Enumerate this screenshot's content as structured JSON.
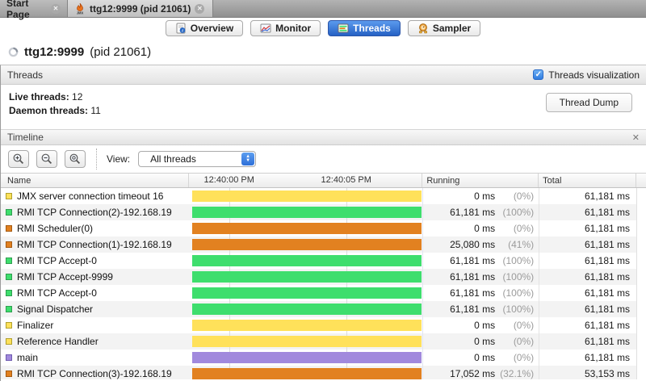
{
  "window": {
    "tabs": [
      {
        "label": "Start Page"
      },
      {
        "label": "ttg12:9999 (pid 21061)"
      }
    ]
  },
  "view_tabs": [
    {
      "label": "Overview"
    },
    {
      "label": "Monitor"
    },
    {
      "label": "Threads",
      "selected": true
    },
    {
      "label": "Sampler"
    }
  ],
  "header": {
    "title": "ttg12:9999",
    "subtitle": "(pid 21061)"
  },
  "threads_panel": {
    "title": "Threads",
    "visualization_label": "Threads visualization",
    "visualization_checked": true,
    "live_threads_label": "Live threads:",
    "live_threads": "12",
    "daemon_threads_label": "Daemon threads:",
    "daemon_threads": "11",
    "thread_dump_label": "Thread Dump"
  },
  "timeline": {
    "title": "Timeline",
    "close_label": "x",
    "view_label": "View:",
    "view_value": "All threads",
    "columns": {
      "name": "Name",
      "running": "Running",
      "total": "Total"
    },
    "time_ticks": [
      "12:40:00 PM",
      "12:40:05 PM"
    ],
    "rows": [
      {
        "name": "JMX server connection timeout 16",
        "color": "yellow",
        "running": "0 ms",
        "pct": "(0%)",
        "total": "61,181 ms"
      },
      {
        "name": "RMI TCP Connection(2)-192.168.19",
        "color": "green",
        "running": "61,181 ms",
        "pct": "(100%)",
        "total": "61,181 ms"
      },
      {
        "name": "RMI Scheduler(0)",
        "color": "orange",
        "running": "0 ms",
        "pct": "(0%)",
        "total": "61,181 ms"
      },
      {
        "name": "RMI TCP Connection(1)-192.168.19",
        "color": "orange",
        "running": "25,080 ms",
        "pct": "(41%)",
        "total": "61,181 ms"
      },
      {
        "name": "RMI TCP Accept-0",
        "color": "green",
        "running": "61,181 ms",
        "pct": "(100%)",
        "total": "61,181 ms"
      },
      {
        "name": "RMI TCP Accept-9999",
        "color": "green",
        "running": "61,181 ms",
        "pct": "(100%)",
        "total": "61,181 ms"
      },
      {
        "name": "RMI TCP Accept-0",
        "color": "green",
        "running": "61,181 ms",
        "pct": "(100%)",
        "total": "61,181 ms"
      },
      {
        "name": "Signal Dispatcher",
        "color": "green",
        "running": "61,181 ms",
        "pct": "(100%)",
        "total": "61,181 ms"
      },
      {
        "name": "Finalizer",
        "color": "yellow",
        "running": "0 ms",
        "pct": "(0%)",
        "total": "61,181 ms"
      },
      {
        "name": "Reference Handler",
        "color": "yellow",
        "running": "0 ms",
        "pct": "(0%)",
        "total": "61,181 ms"
      },
      {
        "name": "main",
        "color": "purple",
        "running": "0 ms",
        "pct": "(0%)",
        "total": "61,181 ms"
      },
      {
        "name": "RMI TCP Connection(3)-192.168.19",
        "color": "orange",
        "running": "17,052 ms",
        "pct": "(32.1%)",
        "total": "53,153 ms"
      }
    ]
  },
  "bar_colors": {
    "yellow": "#FFE15A",
    "green": "#3EDE6D",
    "orange": "#E28120",
    "purple": "#A189DD"
  },
  "swatch_borders": {
    "yellow": "#b0a02d",
    "green": "#2f9e4f",
    "orange": "#a55a12",
    "purple": "#6f5bb0"
  },
  "accent_blue": "#2f7ce0"
}
